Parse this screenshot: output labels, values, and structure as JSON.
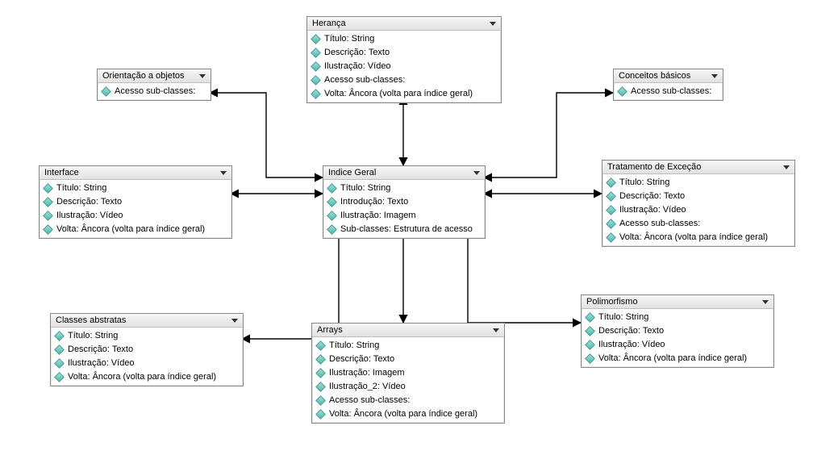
{
  "boxes": {
    "indice_geral": {
      "title": "Indice Geral",
      "rows": [
        "Título: String",
        "Introdução: Texto",
        "Ilustração: Imagem",
        "Sub-classes: Estrutura de acesso"
      ]
    },
    "heranca": {
      "title": "Herança",
      "rows": [
        "Título: String",
        "Descrição: Texto",
        "Ilustração: Vídeo",
        "Acesso sub-classes:",
        "Volta: Âncora (volta para índice geral)"
      ]
    },
    "orientacao": {
      "title": "Orientação a objetos",
      "rows": [
        "Acesso sub-classes:"
      ]
    },
    "conceitos": {
      "title": "Conceitos básicos",
      "rows": [
        "Acesso sub-classes:"
      ]
    },
    "interface": {
      "title": "Interface",
      "rows": [
        "Título: String",
        "Descrição: Texto",
        "Ilustração: Vídeo",
        "Volta: Âncora (volta para índice geral)"
      ]
    },
    "tratamento": {
      "title": "Tratamento de Exceção",
      "rows": [
        "Título: String",
        "Descrição: Texto",
        "Ilustração: Vídeo",
        "Acesso sub-classes:",
        "Volta: Âncora (volta para índice geral)"
      ]
    },
    "classes_abstratas": {
      "title": "Classes abstratas",
      "rows": [
        "Título: String",
        "Descrição: Texto",
        "Ilustração: Vídeo",
        "Volta: Âncora (volta para índice geral)"
      ]
    },
    "arrays": {
      "title": "Arrays",
      "rows": [
        "Título: String",
        "Descrição: Texto",
        "Ilustração: Imagem",
        "Ilustração_2: Vídeo",
        "Acesso sub-classes:",
        "Volta: Âncora (volta para índice geral)"
      ]
    },
    "polimorfismo": {
      "title": "Polimorfismo",
      "rows": [
        "Título: String",
        "Descrição: Texto",
        "Ilustração: Vídeo",
        "Volta: Âncora (volta para índice geral)"
      ]
    }
  }
}
